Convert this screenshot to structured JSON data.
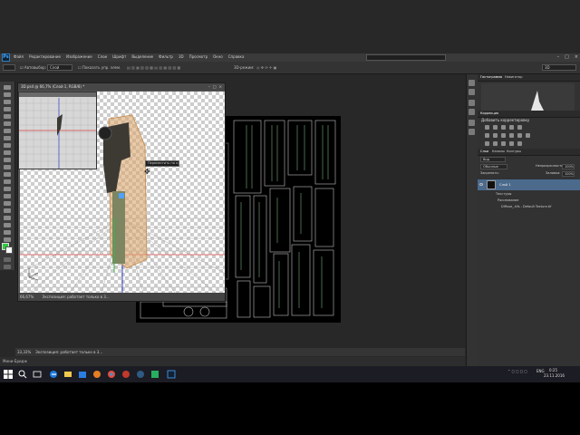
{
  "app": {
    "logo_text": "Ps"
  },
  "menu": [
    "Файл",
    "Редактирование",
    "Изображение",
    "Слои",
    "Шрифт",
    "Выделение",
    "Фильтр",
    "3D",
    "Просмотр",
    "Окно",
    "Справка"
  ],
  "window_controls": [
    "–",
    "□",
    "×"
  ],
  "options_bar": {
    "autoselect_label": "Автовыбор:",
    "autoselect_value": "Слой",
    "transform_label": "Показать упр. элем.",
    "mode3d_label": "3D-режим:",
    "workspace_value": "3D"
  },
  "doc_window": {
    "title": "3D.psd @ 66,7% (Слой 1, RGB/8) *",
    "buttons": [
      "–",
      "□",
      "×"
    ],
    "status_zoom": "66,67%",
    "status_text": "Экспозиция: работает только в 3..."
  },
  "tooltip": "Переместить на х: 0",
  "main_status": {
    "zoom": "33,33%",
    "text": "Экспозиция: работает только в 3..."
  },
  "bottom_tab": "Мини-Бридж",
  "panels": {
    "top_tabs": [
      "Гистограмма",
      "Навигатор"
    ],
    "correction_tab": "Коррекция",
    "correction_title": "Добавить корректировку",
    "layers_tabs": [
      "Слои",
      "Каналы",
      "Контуры"
    ],
    "kind_filter": "Вид",
    "blend_mode": "Обычные",
    "opacity_label": "Непрозрачность:",
    "opacity_value": "100%",
    "lock_label": "Закрепить:",
    "fill_label": "Заливка:",
    "fill_value": "100%",
    "layer_name": "Слой 1",
    "sub_textures": "Текстуры",
    "sub_diffuse": "Рассеивание",
    "sub_file": "Diffuse_.tifs - Default Texture.tif"
  },
  "taskbar": {
    "lang": "ENG",
    "time": "0:25",
    "date": "23.11.2016"
  },
  "colors": {
    "foreground": "#2ecc40",
    "background": "#ffffff",
    "accent": "#4b6a8c"
  }
}
